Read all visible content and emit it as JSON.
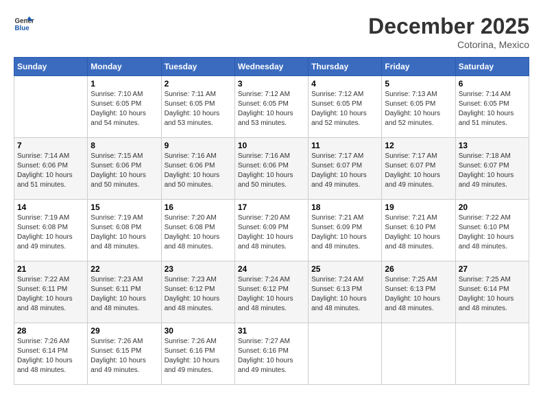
{
  "header": {
    "logo_line1": "General",
    "logo_line2": "Blue",
    "month": "December 2025",
    "location": "Cotorina, Mexico"
  },
  "weekdays": [
    "Sunday",
    "Monday",
    "Tuesday",
    "Wednesday",
    "Thursday",
    "Friday",
    "Saturday"
  ],
  "weeks": [
    [
      {
        "day": "",
        "info": ""
      },
      {
        "day": "1",
        "info": "Sunrise: 7:10 AM\nSunset: 6:05 PM\nDaylight: 10 hours\nand 54 minutes."
      },
      {
        "day": "2",
        "info": "Sunrise: 7:11 AM\nSunset: 6:05 PM\nDaylight: 10 hours\nand 53 minutes."
      },
      {
        "day": "3",
        "info": "Sunrise: 7:12 AM\nSunset: 6:05 PM\nDaylight: 10 hours\nand 53 minutes."
      },
      {
        "day": "4",
        "info": "Sunrise: 7:12 AM\nSunset: 6:05 PM\nDaylight: 10 hours\nand 52 minutes."
      },
      {
        "day": "5",
        "info": "Sunrise: 7:13 AM\nSunset: 6:05 PM\nDaylight: 10 hours\nand 52 minutes."
      },
      {
        "day": "6",
        "info": "Sunrise: 7:14 AM\nSunset: 6:05 PM\nDaylight: 10 hours\nand 51 minutes."
      }
    ],
    [
      {
        "day": "7",
        "info": "Sunrise: 7:14 AM\nSunset: 6:06 PM\nDaylight: 10 hours\nand 51 minutes."
      },
      {
        "day": "8",
        "info": "Sunrise: 7:15 AM\nSunset: 6:06 PM\nDaylight: 10 hours\nand 50 minutes."
      },
      {
        "day": "9",
        "info": "Sunrise: 7:16 AM\nSunset: 6:06 PM\nDaylight: 10 hours\nand 50 minutes."
      },
      {
        "day": "10",
        "info": "Sunrise: 7:16 AM\nSunset: 6:06 PM\nDaylight: 10 hours\nand 50 minutes."
      },
      {
        "day": "11",
        "info": "Sunrise: 7:17 AM\nSunset: 6:07 PM\nDaylight: 10 hours\nand 49 minutes."
      },
      {
        "day": "12",
        "info": "Sunrise: 7:17 AM\nSunset: 6:07 PM\nDaylight: 10 hours\nand 49 minutes."
      },
      {
        "day": "13",
        "info": "Sunrise: 7:18 AM\nSunset: 6:07 PM\nDaylight: 10 hours\nand 49 minutes."
      }
    ],
    [
      {
        "day": "14",
        "info": "Sunrise: 7:19 AM\nSunset: 6:08 PM\nDaylight: 10 hours\nand 49 minutes."
      },
      {
        "day": "15",
        "info": "Sunrise: 7:19 AM\nSunset: 6:08 PM\nDaylight: 10 hours\nand 48 minutes."
      },
      {
        "day": "16",
        "info": "Sunrise: 7:20 AM\nSunset: 6:08 PM\nDaylight: 10 hours\nand 48 minutes."
      },
      {
        "day": "17",
        "info": "Sunrise: 7:20 AM\nSunset: 6:09 PM\nDaylight: 10 hours\nand 48 minutes."
      },
      {
        "day": "18",
        "info": "Sunrise: 7:21 AM\nSunset: 6:09 PM\nDaylight: 10 hours\nand 48 minutes."
      },
      {
        "day": "19",
        "info": "Sunrise: 7:21 AM\nSunset: 6:10 PM\nDaylight: 10 hours\nand 48 minutes."
      },
      {
        "day": "20",
        "info": "Sunrise: 7:22 AM\nSunset: 6:10 PM\nDaylight: 10 hours\nand 48 minutes."
      }
    ],
    [
      {
        "day": "21",
        "info": "Sunrise: 7:22 AM\nSunset: 6:11 PM\nDaylight: 10 hours\nand 48 minutes."
      },
      {
        "day": "22",
        "info": "Sunrise: 7:23 AM\nSunset: 6:11 PM\nDaylight: 10 hours\nand 48 minutes."
      },
      {
        "day": "23",
        "info": "Sunrise: 7:23 AM\nSunset: 6:12 PM\nDaylight: 10 hours\nand 48 minutes."
      },
      {
        "day": "24",
        "info": "Sunrise: 7:24 AM\nSunset: 6:12 PM\nDaylight: 10 hours\nand 48 minutes."
      },
      {
        "day": "25",
        "info": "Sunrise: 7:24 AM\nSunset: 6:13 PM\nDaylight: 10 hours\nand 48 minutes."
      },
      {
        "day": "26",
        "info": "Sunrise: 7:25 AM\nSunset: 6:13 PM\nDaylight: 10 hours\nand 48 minutes."
      },
      {
        "day": "27",
        "info": "Sunrise: 7:25 AM\nSunset: 6:14 PM\nDaylight: 10 hours\nand 48 minutes."
      }
    ],
    [
      {
        "day": "28",
        "info": "Sunrise: 7:26 AM\nSunset: 6:14 PM\nDaylight: 10 hours\nand 48 minutes."
      },
      {
        "day": "29",
        "info": "Sunrise: 7:26 AM\nSunset: 6:15 PM\nDaylight: 10 hours\nand 49 minutes."
      },
      {
        "day": "30",
        "info": "Sunrise: 7:26 AM\nSunset: 6:16 PM\nDaylight: 10 hours\nand 49 minutes."
      },
      {
        "day": "31",
        "info": "Sunrise: 7:27 AM\nSunset: 6:16 PM\nDaylight: 10 hours\nand 49 minutes."
      },
      {
        "day": "",
        "info": ""
      },
      {
        "day": "",
        "info": ""
      },
      {
        "day": "",
        "info": ""
      }
    ]
  ]
}
